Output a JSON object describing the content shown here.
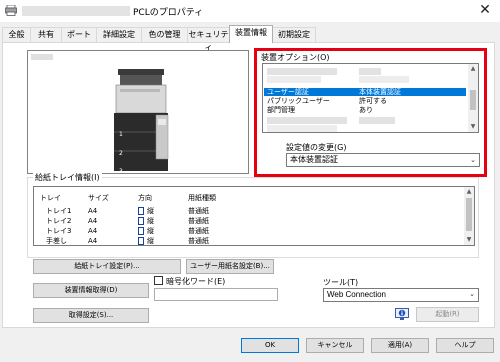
{
  "window": {
    "title": "PCLのプロパティ",
    "close_glyph": "✕"
  },
  "tabs": [
    {
      "label": "全般"
    },
    {
      "label": "共有"
    },
    {
      "label": "ポート"
    },
    {
      "label": "詳細設定"
    },
    {
      "label": "色の管理"
    },
    {
      "label": "セキュリティ"
    },
    {
      "label": "装置情報",
      "active": true
    },
    {
      "label": "初期設定"
    }
  ],
  "preview": {
    "tray_numbers": [
      "1",
      "2",
      "3"
    ]
  },
  "options": {
    "label": "装置オプション(O)",
    "rows": [
      {
        "name": "ユーザー認証",
        "value": "本体装置認証",
        "selected": true
      },
      {
        "name": "パブリックユーザー",
        "value": "許可する"
      },
      {
        "name": "部門管理",
        "value": "あり"
      }
    ]
  },
  "setting_change": {
    "label": "設定値の変更(G)",
    "value": "本体装置認証"
  },
  "tray_info": {
    "label": "給紙トレイ情報(I)",
    "columns": [
      "トレイ",
      "サイズ",
      "方向",
      "用紙種類"
    ],
    "rows": [
      {
        "tray": "トレイ1",
        "size": "A4",
        "orient": "縦",
        "type": "普通紙"
      },
      {
        "tray": "トレイ2",
        "size": "A4",
        "orient": "縦",
        "type": "普通紙"
      },
      {
        "tray": "トレイ3",
        "size": "A4",
        "orient": "縦",
        "type": "普通紙"
      },
      {
        "tray": "手差し",
        "size": "A4",
        "orient": "縦",
        "type": "普通紙"
      }
    ]
  },
  "buttons": {
    "tray_settings": "給紙トレイ設定(P)...",
    "user_paper": "ユーザー用紙名設定(B)...",
    "acquire_device_info": "装置情報取得(D)",
    "acquire_settings": "取得設定(S)...",
    "launch": "起動(R)",
    "ok": "OK",
    "cancel": "キャンセル",
    "apply": "適用(A)",
    "help": "ヘルプ"
  },
  "password": {
    "label": "暗号化ワード(E)",
    "value": ""
  },
  "tool": {
    "label": "ツール(T)",
    "value": "Web Connection"
  },
  "colors": {
    "highlight": "#0078d7",
    "frame_red": "#e60012"
  }
}
